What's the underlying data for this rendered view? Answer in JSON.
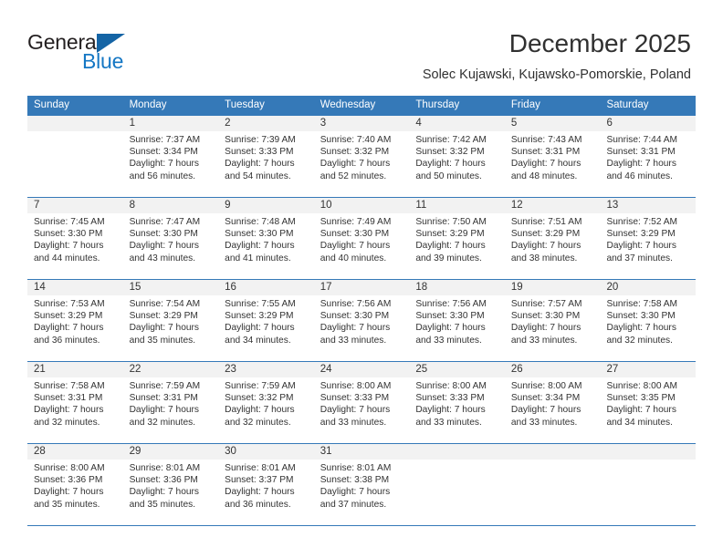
{
  "brand": {
    "word_one": "General",
    "word_two": "Blue",
    "triangle_color": "#1464a5",
    "blue_color": "#1577c4"
  },
  "header": {
    "title": "December 2025",
    "location": "Solec Kujawski, Kujawsko-Pomorskie, Poland"
  },
  "calendar": {
    "header_bg": "#3579b8",
    "day_names": [
      "Sunday",
      "Monday",
      "Tuesday",
      "Wednesday",
      "Thursday",
      "Friday",
      "Saturday"
    ],
    "labels": {
      "sunrise": "Sunrise:",
      "sunset": "Sunset:",
      "daylight": "Daylight:"
    },
    "weeks": [
      {
        "days": [
          {
            "num": "",
            "sunrise": "",
            "sunset": "",
            "daylight": ""
          },
          {
            "num": "1",
            "sunrise": "Sunrise: 7:37 AM",
            "sunset": "Sunset: 3:34 PM",
            "daylight": "Daylight: 7 hours and 56 minutes."
          },
          {
            "num": "2",
            "sunrise": "Sunrise: 7:39 AM",
            "sunset": "Sunset: 3:33 PM",
            "daylight": "Daylight: 7 hours and 54 minutes."
          },
          {
            "num": "3",
            "sunrise": "Sunrise: 7:40 AM",
            "sunset": "Sunset: 3:32 PM",
            "daylight": "Daylight: 7 hours and 52 minutes."
          },
          {
            "num": "4",
            "sunrise": "Sunrise: 7:42 AM",
            "sunset": "Sunset: 3:32 PM",
            "daylight": "Daylight: 7 hours and 50 minutes."
          },
          {
            "num": "5",
            "sunrise": "Sunrise: 7:43 AM",
            "sunset": "Sunset: 3:31 PM",
            "daylight": "Daylight: 7 hours and 48 minutes."
          },
          {
            "num": "6",
            "sunrise": "Sunrise: 7:44 AM",
            "sunset": "Sunset: 3:31 PM",
            "daylight": "Daylight: 7 hours and 46 minutes."
          }
        ]
      },
      {
        "days": [
          {
            "num": "7",
            "sunrise": "Sunrise: 7:45 AM",
            "sunset": "Sunset: 3:30 PM",
            "daylight": "Daylight: 7 hours and 44 minutes."
          },
          {
            "num": "8",
            "sunrise": "Sunrise: 7:47 AM",
            "sunset": "Sunset: 3:30 PM",
            "daylight": "Daylight: 7 hours and 43 minutes."
          },
          {
            "num": "9",
            "sunrise": "Sunrise: 7:48 AM",
            "sunset": "Sunset: 3:30 PM",
            "daylight": "Daylight: 7 hours and 41 minutes."
          },
          {
            "num": "10",
            "sunrise": "Sunrise: 7:49 AM",
            "sunset": "Sunset: 3:30 PM",
            "daylight": "Daylight: 7 hours and 40 minutes."
          },
          {
            "num": "11",
            "sunrise": "Sunrise: 7:50 AM",
            "sunset": "Sunset: 3:29 PM",
            "daylight": "Daylight: 7 hours and 39 minutes."
          },
          {
            "num": "12",
            "sunrise": "Sunrise: 7:51 AM",
            "sunset": "Sunset: 3:29 PM",
            "daylight": "Daylight: 7 hours and 38 minutes."
          },
          {
            "num": "13",
            "sunrise": "Sunrise: 7:52 AM",
            "sunset": "Sunset: 3:29 PM",
            "daylight": "Daylight: 7 hours and 37 minutes."
          }
        ]
      },
      {
        "days": [
          {
            "num": "14",
            "sunrise": "Sunrise: 7:53 AM",
            "sunset": "Sunset: 3:29 PM",
            "daylight": "Daylight: 7 hours and 36 minutes."
          },
          {
            "num": "15",
            "sunrise": "Sunrise: 7:54 AM",
            "sunset": "Sunset: 3:29 PM",
            "daylight": "Daylight: 7 hours and 35 minutes."
          },
          {
            "num": "16",
            "sunrise": "Sunrise: 7:55 AM",
            "sunset": "Sunset: 3:29 PM",
            "daylight": "Daylight: 7 hours and 34 minutes."
          },
          {
            "num": "17",
            "sunrise": "Sunrise: 7:56 AM",
            "sunset": "Sunset: 3:30 PM",
            "daylight": "Daylight: 7 hours and 33 minutes."
          },
          {
            "num": "18",
            "sunrise": "Sunrise: 7:56 AM",
            "sunset": "Sunset: 3:30 PM",
            "daylight": "Daylight: 7 hours and 33 minutes."
          },
          {
            "num": "19",
            "sunrise": "Sunrise: 7:57 AM",
            "sunset": "Sunset: 3:30 PM",
            "daylight": "Daylight: 7 hours and 33 minutes."
          },
          {
            "num": "20",
            "sunrise": "Sunrise: 7:58 AM",
            "sunset": "Sunset: 3:30 PM",
            "daylight": "Daylight: 7 hours and 32 minutes."
          }
        ]
      },
      {
        "days": [
          {
            "num": "21",
            "sunrise": "Sunrise: 7:58 AM",
            "sunset": "Sunset: 3:31 PM",
            "daylight": "Daylight: 7 hours and 32 minutes."
          },
          {
            "num": "22",
            "sunrise": "Sunrise: 7:59 AM",
            "sunset": "Sunset: 3:31 PM",
            "daylight": "Daylight: 7 hours and 32 minutes."
          },
          {
            "num": "23",
            "sunrise": "Sunrise: 7:59 AM",
            "sunset": "Sunset: 3:32 PM",
            "daylight": "Daylight: 7 hours and 32 minutes."
          },
          {
            "num": "24",
            "sunrise": "Sunrise: 8:00 AM",
            "sunset": "Sunset: 3:33 PM",
            "daylight": "Daylight: 7 hours and 33 minutes."
          },
          {
            "num": "25",
            "sunrise": "Sunrise: 8:00 AM",
            "sunset": "Sunset: 3:33 PM",
            "daylight": "Daylight: 7 hours and 33 minutes."
          },
          {
            "num": "26",
            "sunrise": "Sunrise: 8:00 AM",
            "sunset": "Sunset: 3:34 PM",
            "daylight": "Daylight: 7 hours and 33 minutes."
          },
          {
            "num": "27",
            "sunrise": "Sunrise: 8:00 AM",
            "sunset": "Sunset: 3:35 PM",
            "daylight": "Daylight: 7 hours and 34 minutes."
          }
        ]
      },
      {
        "days": [
          {
            "num": "28",
            "sunrise": "Sunrise: 8:00 AM",
            "sunset": "Sunset: 3:36 PM",
            "daylight": "Daylight: 7 hours and 35 minutes."
          },
          {
            "num": "29",
            "sunrise": "Sunrise: 8:01 AM",
            "sunset": "Sunset: 3:36 PM",
            "daylight": "Daylight: 7 hours and 35 minutes."
          },
          {
            "num": "30",
            "sunrise": "Sunrise: 8:01 AM",
            "sunset": "Sunset: 3:37 PM",
            "daylight": "Daylight: 7 hours and 36 minutes."
          },
          {
            "num": "31",
            "sunrise": "Sunrise: 8:01 AM",
            "sunset": "Sunset: 3:38 PM",
            "daylight": "Daylight: 7 hours and 37 minutes."
          },
          {
            "num": "",
            "sunrise": "",
            "sunset": "",
            "daylight": ""
          },
          {
            "num": "",
            "sunrise": "",
            "sunset": "",
            "daylight": ""
          },
          {
            "num": "",
            "sunrise": "",
            "sunset": "",
            "daylight": ""
          }
        ]
      }
    ]
  }
}
